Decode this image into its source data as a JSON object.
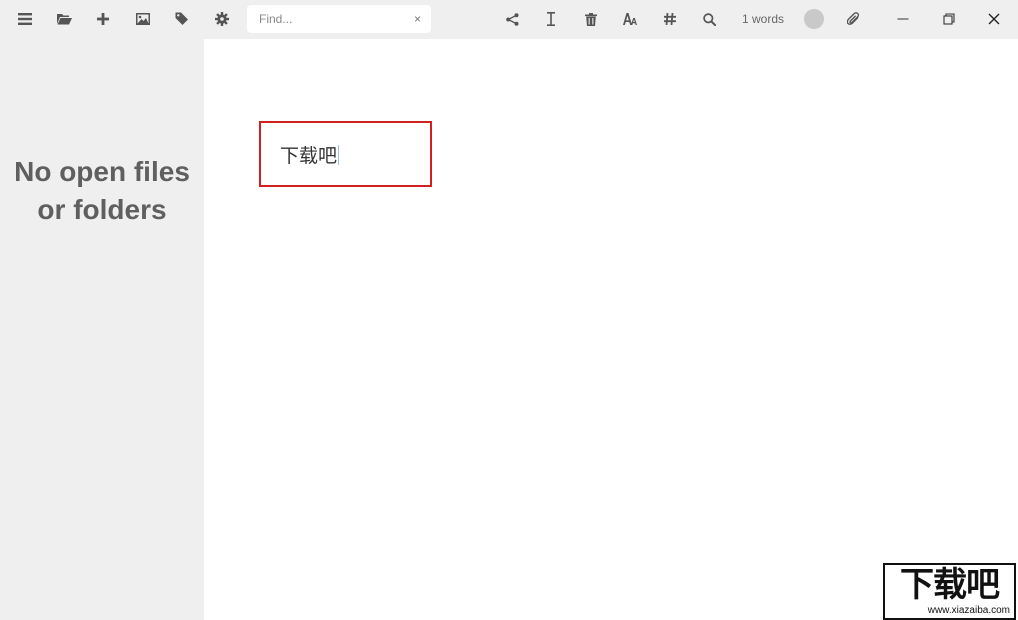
{
  "toolbar": {
    "left_icons": [
      "menu-icon",
      "folder-open-icon",
      "add-icon",
      "image-icon",
      "tag-icon",
      "settings-icon"
    ],
    "search": {
      "placeholder": "Find...",
      "value": "",
      "clear_label": "×"
    },
    "right_icons": [
      "share-icon",
      "text-cursor-icon",
      "trash-icon",
      "font-icon",
      "hashtag-icon",
      "search-icon"
    ],
    "word_count": "1 words",
    "window_controls": [
      "minimize-icon",
      "restore-icon",
      "close-icon"
    ]
  },
  "sidebar": {
    "empty_message_line1": "No open files",
    "empty_message_line2": "or folders"
  },
  "editor": {
    "content": "下载吧"
  },
  "watermark": {
    "text": "下载吧",
    "url": "www.xiazaiba.com"
  },
  "colors": {
    "toolbar_bg": "#efefef",
    "sidebar_bg": "#efefef",
    "editor_bg": "#ffffff",
    "highlight_border": "#d41f1f",
    "icon_color": "#555555"
  }
}
